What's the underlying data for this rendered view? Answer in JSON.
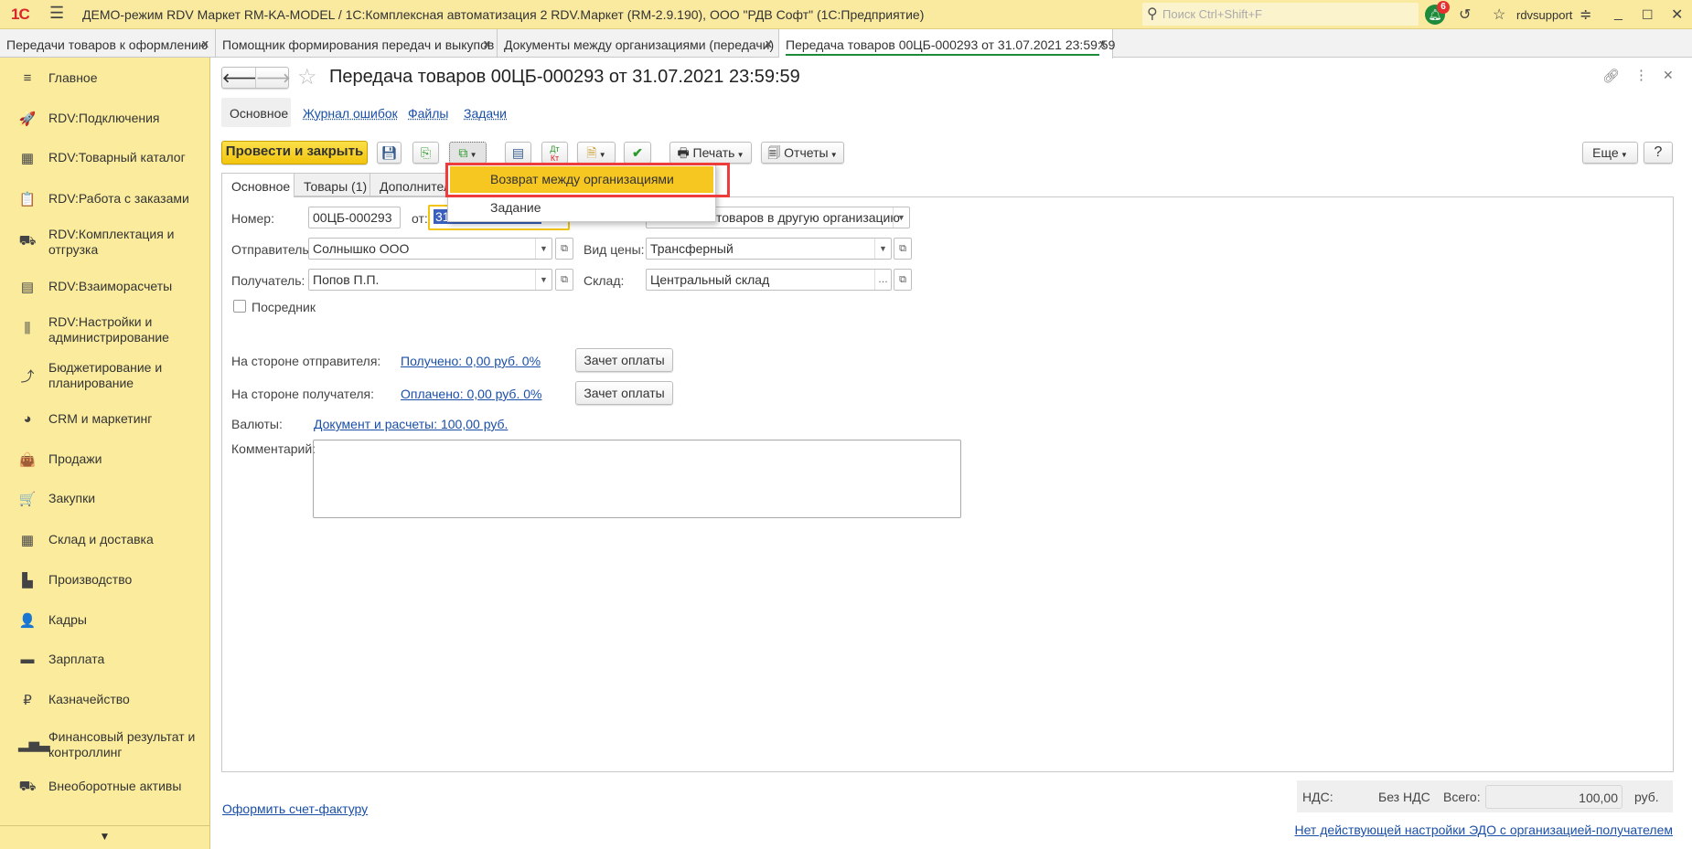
{
  "topbar": {
    "logo": "1С",
    "title": "ДЕМО-режим RDV Маркет RM-KA-MODEL / 1С:Комплексная автоматизация 2 RDV.Маркет (RM-2.9.190), ООО \"РДВ Софт\"  (1С:Предприятие)",
    "search_placeholder": "Поиск Ctrl+Shift+F",
    "notifications": "6",
    "user": "rdvsupport"
  },
  "tabs": [
    {
      "label": "Передачи товаров к оформлению"
    },
    {
      "label": "Помощник формирования передач и выкупов"
    },
    {
      "label": "Документы между организациями (передачи)"
    },
    {
      "label": "Передача товаров 00ЦБ-000293 от 31.07.2021 23:59:59",
      "active": true
    }
  ],
  "sidebar": {
    "items": [
      {
        "label": "Главное",
        "icon": "≡"
      },
      {
        "label": "RDV:Подключения",
        "icon": "🚀"
      },
      {
        "label": "RDV:Товарный каталог",
        "icon": "▦"
      },
      {
        "label": "RDV:Работа с заказами",
        "icon": "📋"
      },
      {
        "label": "RDV:Комплектация и отгрузка",
        "icon": "⛟"
      },
      {
        "label": "RDV:Взаиморасчеты",
        "icon": "▤"
      },
      {
        "label": "RDV:Настройки и администрирование",
        "icon": "⫼"
      },
      {
        "label": "Бюджетирование и планирование",
        "icon": "⤴"
      },
      {
        "label": "CRM и маркетинг",
        "icon": "◕"
      },
      {
        "label": "Продажи",
        "icon": "👜"
      },
      {
        "label": "Закупки",
        "icon": "🛒"
      },
      {
        "label": "Склад и доставка",
        "icon": "▦"
      },
      {
        "label": "Производство",
        "icon": "▙"
      },
      {
        "label": "Кадры",
        "icon": "👤"
      },
      {
        "label": "Зарплата",
        "icon": "▬"
      },
      {
        "label": "Казначейство",
        "icon": "₽"
      },
      {
        "label": "Финансовый результат и контроллинг",
        "icon": "▂▅▃"
      },
      {
        "label": "Внеоборотные активы",
        "icon": "⛟"
      }
    ]
  },
  "doc": {
    "title": "Передача товаров 00ЦБ-000293 от 31.07.2021 23:59:59",
    "nav": [
      "Основное",
      "Журнал ошибок",
      "Файлы",
      "Задачи"
    ],
    "toolbar": {
      "post_close": "Провести и закрыть",
      "print": "Печать",
      "reports": "Отчеты",
      "more": "Еще",
      "help": "?"
    },
    "form_tabs": [
      "Основное",
      "Товары (1)",
      "Дополнител"
    ],
    "menu": [
      "Возврат между организациями",
      "Задание"
    ],
    "fields": {
      "number_label": "Номер:",
      "number": "00ЦБ-000293",
      "date_label": "от:",
      "date_selected": "31",
      "operation": "товаров в другую организацию",
      "sender_label": "Отправитель:",
      "sender": "Солнышко ООО",
      "price_type_label": "Вид цены:",
      "price_type": "Трансферный",
      "receiver_label": "Получатель:",
      "receiver": "Попов П.П.",
      "warehouse_label": "Склад:",
      "warehouse": "Центральный склад",
      "intermediary": "Посредник"
    },
    "payments": {
      "sender_side_label": "На стороне отправителя:",
      "sender_side_link": "Получено: 0,00 руб.  0%",
      "receiver_side_label": "На стороне получателя:",
      "receiver_side_link": "Оплачено: 0,00 руб.  0%",
      "offset_button": "Зачет оплаты",
      "currency_label": "Валюты:",
      "currency_link": "Документ и расчеты: 100,00 руб.",
      "comment_label": "Комментарий:"
    },
    "footer": {
      "invoice_link": "Оформить счет-фактуру",
      "vat_label": "НДС:",
      "vat_value": "Без НДС",
      "total_label": "Всего:",
      "total": "100,00",
      "currency": "руб.",
      "edo_link": "Нет действующей настройки ЭДО с организацией-получателем"
    }
  },
  "colors": {
    "accent": "#f6c721",
    "sidebar": "#fbec9d",
    "link": "#1a4fa8",
    "highlight_box": "#ee3b3b"
  }
}
